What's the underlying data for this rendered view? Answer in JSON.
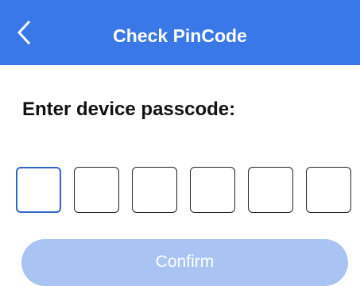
{
  "header": {
    "title": "Check PinCode",
    "back_icon": "chevron-left-icon",
    "background_color": "#3a78e8"
  },
  "form": {
    "prompt": "Enter device passcode:",
    "pin_length": 6,
    "pin_values": [
      "",
      "",
      "",
      "",
      "",
      ""
    ],
    "active_index": 0
  },
  "confirm": {
    "label": "Confirm",
    "enabled": false,
    "color": "#a9c4f2"
  }
}
